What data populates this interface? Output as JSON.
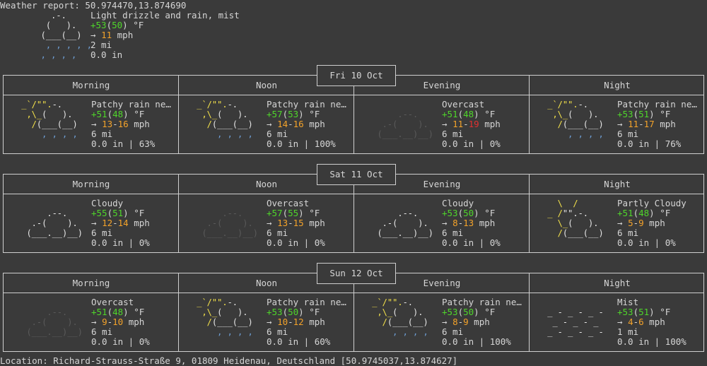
{
  "report": {
    "header": "Weather report: 50.974470,13.874690",
    "current": {
      "desc": "Light drizzle and rain, mist",
      "temp": "+53",
      "feels": "50",
      "unit": "°F",
      "wind": "11",
      "wind_unit": "mph",
      "vis": "2 mi",
      "precip": "0.0 in"
    },
    "location": "Location: Richard-Strauss-Straße 9, 01809 Heidenau, Deutschland [50.9745037,13.874627]"
  },
  "period_labels": [
    "Morning",
    "Noon",
    "Evening",
    "Night"
  ],
  "days": [
    {
      "date": "Fri 10 Oct",
      "periods": [
        {
          "art": "rain",
          "desc": "Patchy rain ne…",
          "temp": "+51",
          "feels": "48",
          "wind_a": "13",
          "wind_b": "16",
          "vis": "6 mi",
          "precip": "0.0 in | 63%"
        },
        {
          "art": "rain",
          "desc": "Patchy rain ne…",
          "temp": "+57",
          "feels": "53",
          "wind_a": "14",
          "wind_b": "16",
          "vis": "6 mi",
          "precip": "0.0 in | 100%"
        },
        {
          "art": "overcast",
          "desc": "Overcast",
          "temp": "+51",
          "feels": "48",
          "wind_a": "11",
          "wind_b": "19",
          "vis": "6 mi",
          "precip": "0.0 in | 0%"
        },
        {
          "art": "rain",
          "desc": "Patchy rain ne…",
          "temp": "+53",
          "feels": "51",
          "wind_a": "11",
          "wind_b": "17",
          "vis": "6 mi",
          "precip": "0.0 in | 76%"
        }
      ]
    },
    {
      "date": "Sat 11 Oct",
      "periods": [
        {
          "art": "cloudy",
          "desc": "Cloudy",
          "temp": "+55",
          "feels": "51",
          "wind_a": "12",
          "wind_b": "14",
          "vis": "6 mi",
          "precip": "0.0 in | 0%"
        },
        {
          "art": "overcast",
          "desc": "Overcast",
          "temp": "+57",
          "feels": "55",
          "wind_a": "13",
          "wind_b": "15",
          "vis": "6 mi",
          "precip": "0.0 in | 0%"
        },
        {
          "art": "cloudy",
          "desc": "Cloudy",
          "temp": "+53",
          "feels": "50",
          "wind_a": "8",
          "wind_b": "13",
          "vis": "6 mi",
          "precip": "0.0 in | 0%"
        },
        {
          "art": "partly",
          "desc": "Partly Cloudy",
          "temp": "+51",
          "feels": "48",
          "wind_a": "5",
          "wind_b": "9",
          "vis": "6 mi",
          "precip": "0.0 in | 0%"
        }
      ]
    },
    {
      "date": "Sun 12 Oct",
      "periods": [
        {
          "art": "overcast",
          "desc": "Overcast",
          "temp": "+51",
          "feels": "48",
          "wind_a": "9",
          "wind_b": "10",
          "vis": "6 mi",
          "precip": "0.0 in | 0%"
        },
        {
          "art": "rain",
          "desc": "Patchy rain ne…",
          "temp": "+53",
          "feels": "50",
          "wind_a": "10",
          "wind_b": "12",
          "vis": "6 mi",
          "precip": "0.0 in | 60%"
        },
        {
          "art": "rain",
          "desc": "Patchy rain ne…",
          "temp": "+53",
          "feels": "50",
          "wind_a": "8",
          "wind_b": "9",
          "vis": "6 mi",
          "precip": "0.0 in | 100%"
        },
        {
          "art": "mist",
          "desc": "Mist",
          "temp": "+53",
          "feels": "51",
          "wind_a": "4",
          "wind_b": "6",
          "vis": "1 mi",
          "precip": "0.0 in | 100%"
        }
      ]
    }
  ]
}
